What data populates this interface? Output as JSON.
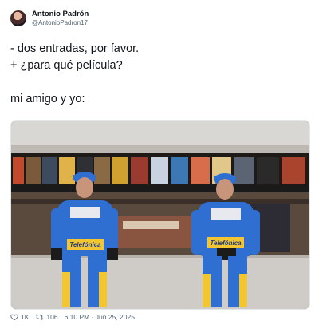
{
  "author": {
    "display_name": "Antonio Padrón",
    "handle": "@AntonioPadron17"
  },
  "tweet": {
    "lines": [
      "- dos entradas, por favor.",
      "+ ¿para qué película?",
      "",
      "mi amigo y yo:"
    ]
  },
  "media": {
    "suit_text_left": "Telefónica",
    "suit_text_right": "Telefónica"
  },
  "footer": {
    "likes": "1K",
    "retweets": "106",
    "timestamp": "6:10 PM · Jun 25, 2025"
  },
  "colors": {
    "suit_blue": "#2f6fd1",
    "suit_yellow": "#f2c531",
    "text_secondary": "#536471"
  },
  "icons": [
    "heart-icon",
    "retweet-icon"
  ]
}
